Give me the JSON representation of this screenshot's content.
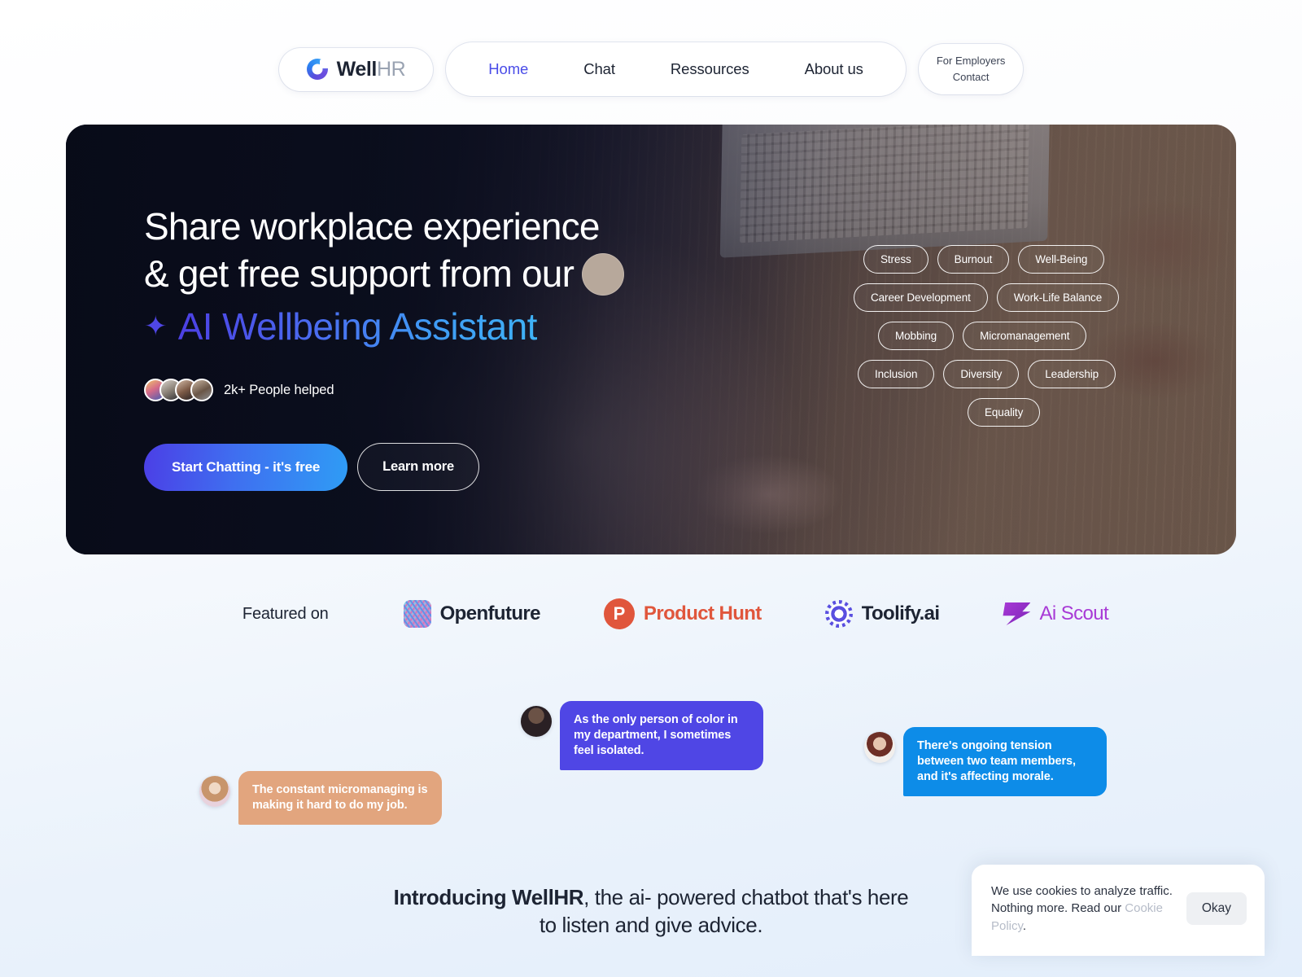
{
  "nav": {
    "logo": {
      "bold": "Well",
      "light": "HR"
    },
    "menu": [
      {
        "label": "Home",
        "active": true
      },
      {
        "label": "Chat",
        "active": false
      },
      {
        "label": "Ressources",
        "active": false
      },
      {
        "label": "About us",
        "active": false
      }
    ],
    "cta": {
      "line1": "For Employers",
      "line2": "Contact"
    }
  },
  "hero": {
    "headline_line1": "Share workplace experience",
    "headline_line2": "& get free support from our",
    "headline_gradient": "AI Wellbeing Assistant",
    "sparkle_icon": "sparkle-icon",
    "social_proof": "2k+ People helped",
    "primary_button": "Start Chatting - it's free",
    "secondary_button": "Learn more",
    "tags": [
      [
        "Stress",
        "Burnout",
        "Well-Being"
      ],
      [
        "Career Development",
        "Work-Life Balance"
      ],
      [
        "Mobbing",
        "Micromanagement"
      ],
      [
        "Inclusion",
        "Diversity",
        "Leadership"
      ],
      [
        "Equality"
      ]
    ],
    "accent_gradient_from": "#4c3fe4",
    "accent_gradient_to": "#3fb3f6"
  },
  "featured": {
    "label": "Featured on",
    "brands": [
      {
        "name": "Openfuture",
        "color": "#1d2433",
        "icon": "openfuture-icon"
      },
      {
        "name": "Product Hunt",
        "color": "#e0563c",
        "icon": "product-hunt-icon"
      },
      {
        "name": "Toolify.ai",
        "color": "#1d2433",
        "icon": "toolify-icon"
      },
      {
        "name": "Ai Scout",
        "color": "#a83ad6",
        "icon": "ai-scout-icon"
      }
    ]
  },
  "chat": {
    "bubbles": [
      {
        "text": "As the only person of color in my department, I sometimes feel isolated.",
        "color": "#4f46e5"
      },
      {
        "text": "There's ongoing tension between two team members, and it's affecting morale.",
        "color": "#0d8ce8"
      },
      {
        "text": "The constant micromanaging is making it hard to do my job.",
        "color": "#e2a57e"
      }
    ]
  },
  "intro": {
    "bold": "Introducing WellHR",
    "rest": ", the ai- powered chatbot that's here",
    "line2": "to listen and give advice."
  },
  "cookie": {
    "text_part1": "We use cookies to analyze traffic. Nothing more. Read our ",
    "link": "Cookie Policy",
    "text_part2": ".",
    "button": "Okay"
  }
}
